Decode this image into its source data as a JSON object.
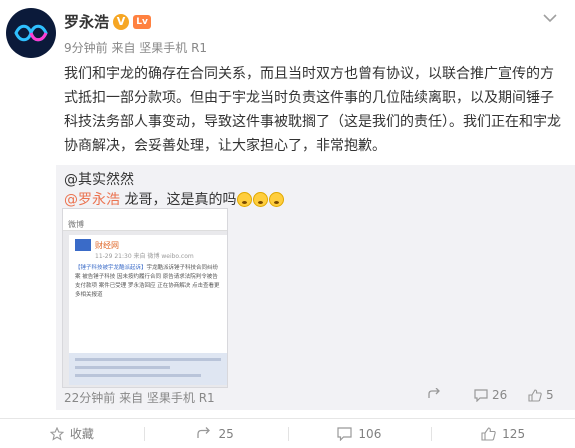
{
  "post": {
    "author": "罗永浩",
    "verified_badge": "V",
    "level_badge": "Lv",
    "meta": "9分钟前 来自 坚果手机 R1",
    "content": "我们和宇龙的确存在合同关系，而且当时双方也曾有协议，以联合推广宣传的方式抵扣一部分款项。但由于宇龙当时负责这件事的几位陆续离职，以及期间锤子科技法务部人事变动，导致这件事被耽搁了（这是我们的责任）。我们正在和宇龙协商解决，会妥善处理，让大家担心了，非常抱歉。"
  },
  "repost": {
    "author": "@其实然然",
    "mention": "@罗永浩",
    "text": " 龙哥，这是真的吗",
    "meta": "22分钟前 来自 坚果手机 R1",
    "share_label": "",
    "comment_count": "26",
    "like_count": "5",
    "screenshot": {
      "topbar": "微博",
      "source_name": "财经网",
      "source_time": "11-29 21:30 来自 微博 weibo.com",
      "body_tag": "【锤子科技被宇龙酷派起诉】",
      "body_text": "宇龙酷派诉锤子科技合同纠纷案 被告锤子科技 因未按约履行合同 原告请求法院判令被告支付款项 案件已受理 罗永浩回应 正在协商解决 点击查看更多相关报道"
    }
  },
  "actions": {
    "favorite_label": "收藏",
    "repost_count": "25",
    "comment_count": "106",
    "like_count": "125"
  },
  "colors": {
    "mention": "#eb7350",
    "meta": "#888888",
    "repost_bg": "#f2f2f5"
  }
}
